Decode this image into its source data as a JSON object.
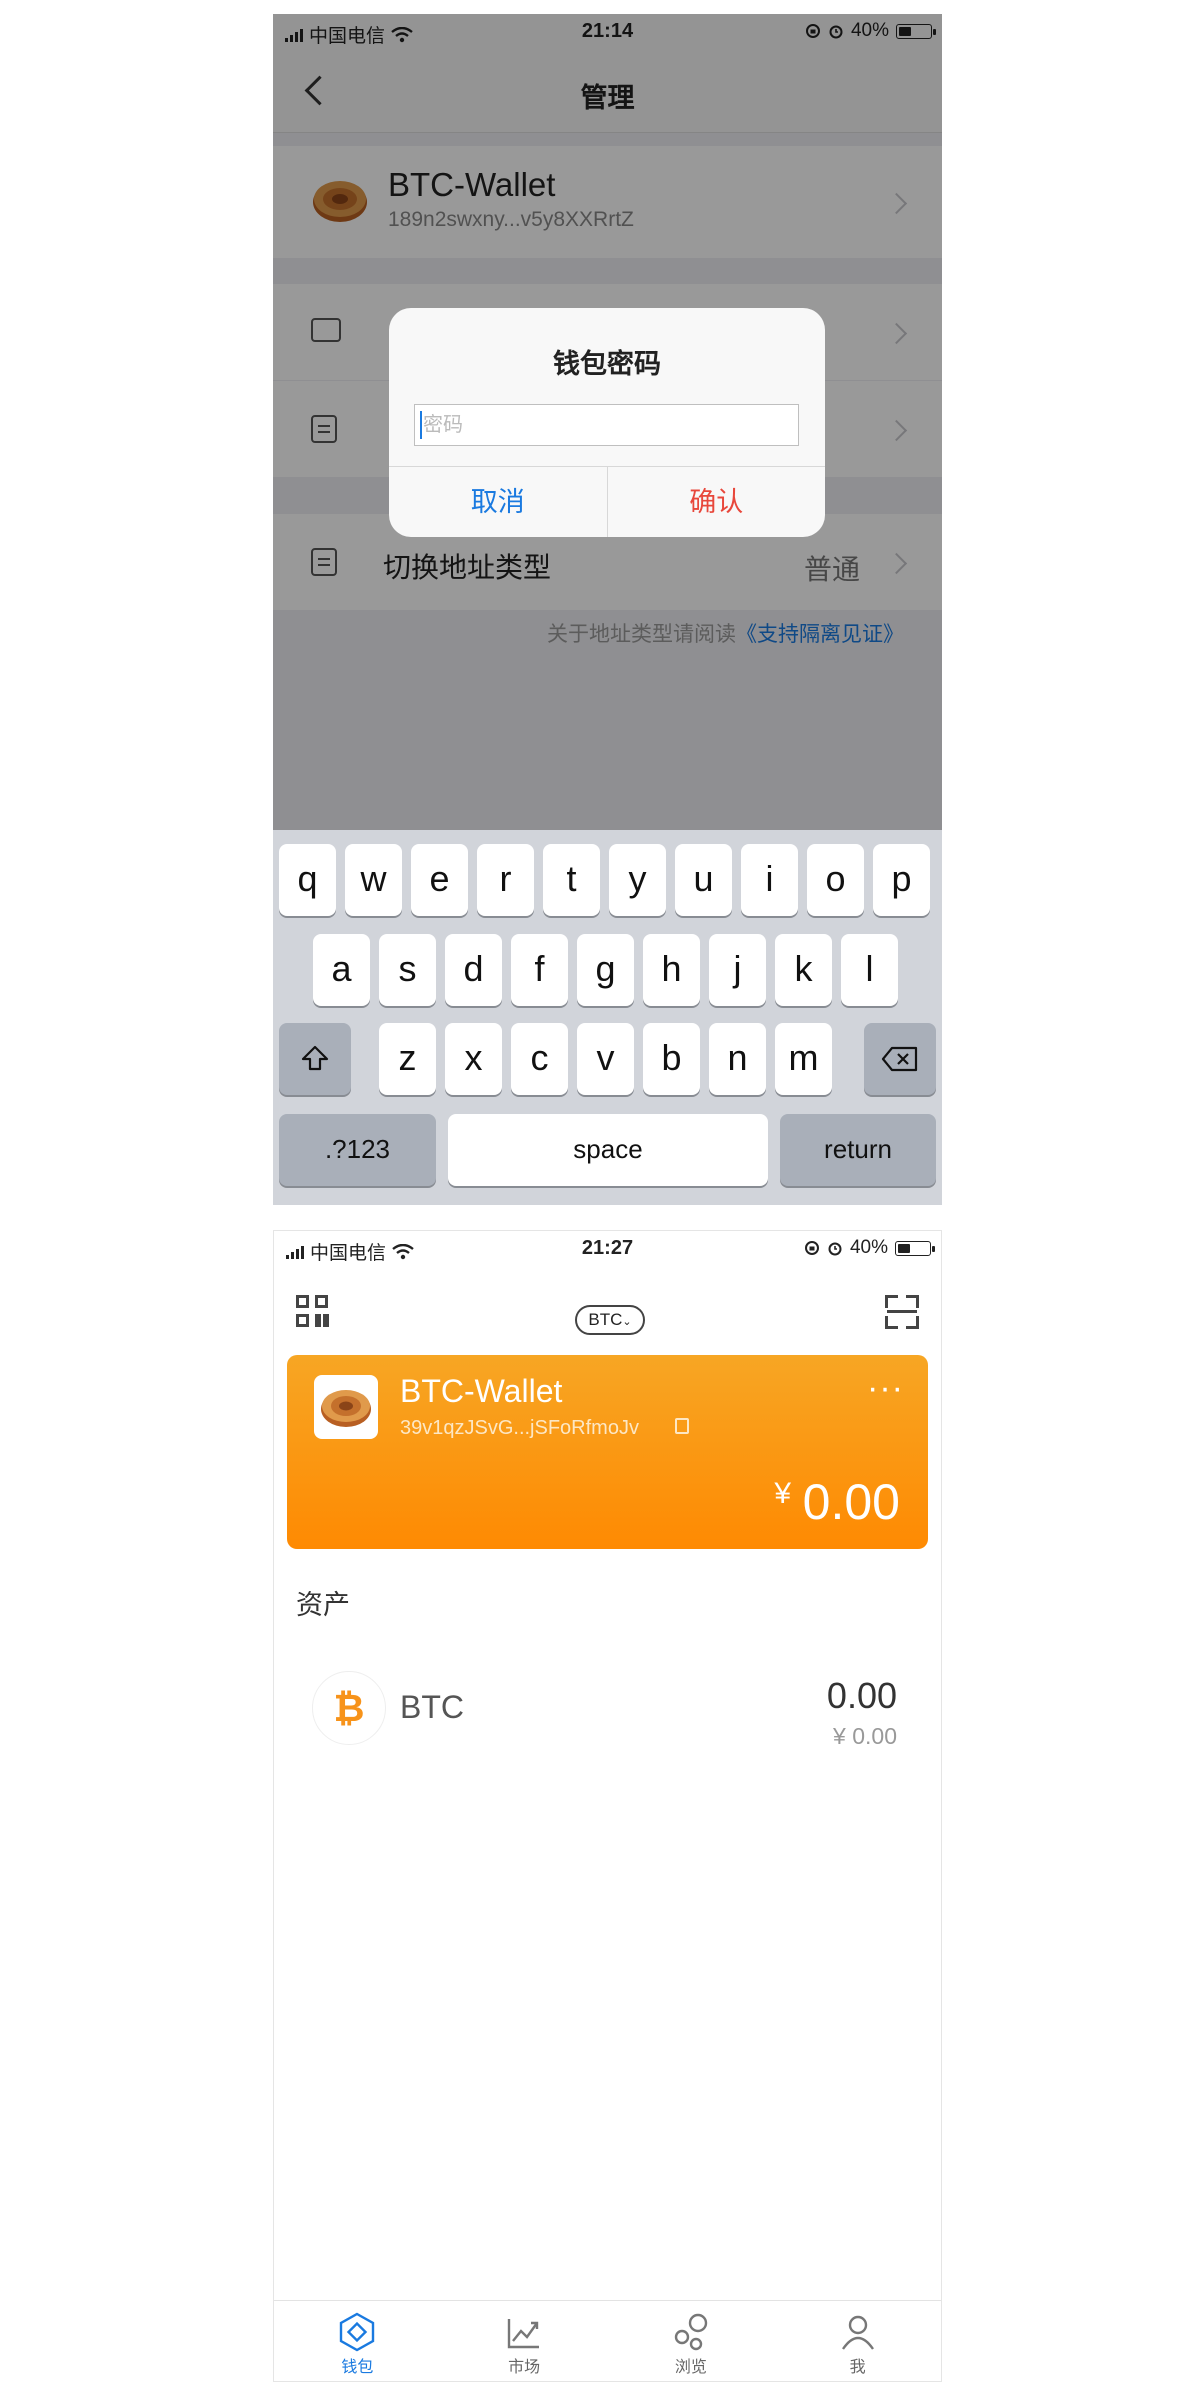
{
  "phone1": {
    "status": {
      "carrier": "中国电信",
      "time": "21:14",
      "battery": "40%",
      "battery_level": 0.4
    },
    "nav": {
      "title": "管理"
    },
    "wallet": {
      "name": "BTC-Wallet",
      "address": "189n2swxny...v5y8XXRrtZ"
    },
    "menu": {
      "address_type_label": "切换地址类型",
      "address_type_value": "普通"
    },
    "footnote": {
      "text": "关于地址类型请阅读",
      "link": "《支持隔离见证》"
    },
    "dialog": {
      "title": "钱包密码",
      "placeholder": "密码",
      "cancel": "取消",
      "confirm": "确认"
    },
    "keyboard": {
      "row1": [
        "q",
        "w",
        "e",
        "r",
        "t",
        "y",
        "u",
        "i",
        "o",
        "p"
      ],
      "row2": [
        "a",
        "s",
        "d",
        "f",
        "g",
        "h",
        "j",
        "k",
        "l"
      ],
      "row3": [
        "z",
        "x",
        "c",
        "v",
        "b",
        "n",
        "m"
      ],
      "numbers": ".?123",
      "space": "space",
      "return": "return"
    }
  },
  "phone2": {
    "status": {
      "carrier": "中国电信",
      "time": "21:27",
      "battery": "40%",
      "battery_level": 0.4
    },
    "header": {
      "coin": "BTC"
    },
    "card": {
      "name": "BTC-Wallet",
      "address": "39v1qzJSvG...jSFoRfmoJv",
      "more": "···",
      "currency": "¥",
      "total": "0.00"
    },
    "assets": {
      "title": "资产",
      "items": [
        {
          "symbol": "BTC",
          "amount": "0.00",
          "fiat": "¥ 0.00"
        }
      ]
    },
    "tabs": [
      {
        "label": "钱包",
        "icon": "wallet-icon",
        "active": true
      },
      {
        "label": "市场",
        "icon": "market-icon",
        "active": false
      },
      {
        "label": "浏览",
        "icon": "browse-icon",
        "active": false
      },
      {
        "label": "我",
        "icon": "me-icon",
        "active": false
      }
    ],
    "colors": {
      "accent": "#1a7ae0",
      "card_top": "#f7a624",
      "card_bottom": "#fe8a02",
      "btc": "#f7931a"
    }
  }
}
